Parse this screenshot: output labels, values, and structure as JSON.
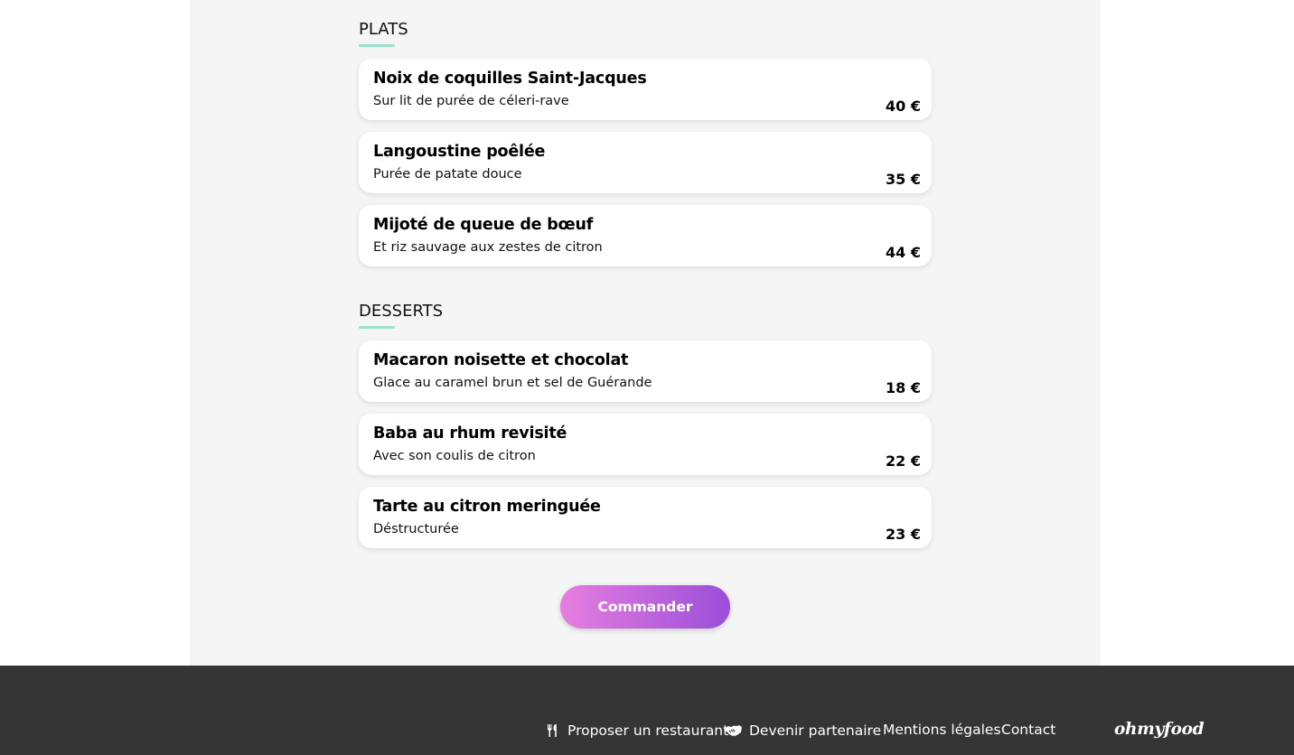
{
  "sections": [
    {
      "title": "PLATS",
      "items": [
        {
          "name": "Noix de coquilles Saint-Jacques",
          "description": "Sur lit de purée de céleri-rave",
          "price": "40 €"
        },
        {
          "name": "Langoustine poêlée",
          "description": "Purée de patate douce",
          "price": "35 €"
        },
        {
          "name": "Mijoté de queue de bœuf",
          "description": "Et riz sauvage aux zestes de citron",
          "price": "44 €"
        }
      ]
    },
    {
      "title": "DESSERTS",
      "items": [
        {
          "name": "Macaron noisette et chocolat",
          "description": "Glace au caramel brun et sel de Guérande",
          "price": "18 €"
        },
        {
          "name": "Baba au rhum revisité",
          "description": "Avec son coulis de citron",
          "price": "22 €"
        },
        {
          "name": "Tarte au citron meringuée",
          "description": "Déstructurée",
          "price": "23 €"
        }
      ]
    }
  ],
  "order_button": {
    "label": "Commander"
  },
  "footer": {
    "links": [
      {
        "label": "Proposer un restaurant",
        "icon": "utensils-icon"
      },
      {
        "label": "Devenir partenaire",
        "icon": "handshake-icon"
      },
      {
        "label": "Mentions légales"
      },
      {
        "label": "Contact"
      }
    ],
    "logo": "ohmyfood"
  },
  "colors": {
    "page_background": "#f5f5f5",
    "underline_accent": "#99e2d0",
    "button_gradient_start": "#e77ee0",
    "button_gradient_end": "#9a4ed8",
    "footer_background": "#353535"
  }
}
